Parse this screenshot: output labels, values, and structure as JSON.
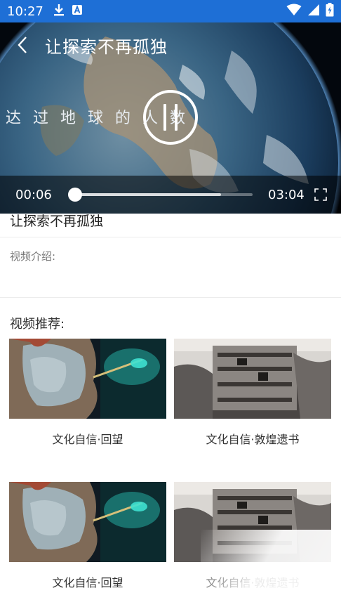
{
  "status_bar": {
    "time": "10:27",
    "icons": [
      "download-icon",
      "a-notification-icon",
      "wifi-icon",
      "signal-icon",
      "battery-icon"
    ],
    "bg_color": "#1e6fd6"
  },
  "player": {
    "title": "让探索不再孤独",
    "subtitle": "达过地球的人数",
    "current_time": "00:06",
    "total_time": "03:04",
    "progress_fraction": 0.033,
    "buffered_fraction": 0.83,
    "state": "playing"
  },
  "details": {
    "video_name": "让探索不再孤独",
    "intro_label": "视频介绍:"
  },
  "recommendations": {
    "title": "视频推荐:",
    "items": [
      {
        "label": "文化自信·回望",
        "thumb": "statue"
      },
      {
        "label": "文化自信·敦煌遗书",
        "thumb": "grottoes"
      },
      {
        "label": "文化自信·回望",
        "thumb": "statue"
      },
      {
        "label": "文化自信·敦煌遗书",
        "thumb": "grottoes"
      }
    ]
  }
}
